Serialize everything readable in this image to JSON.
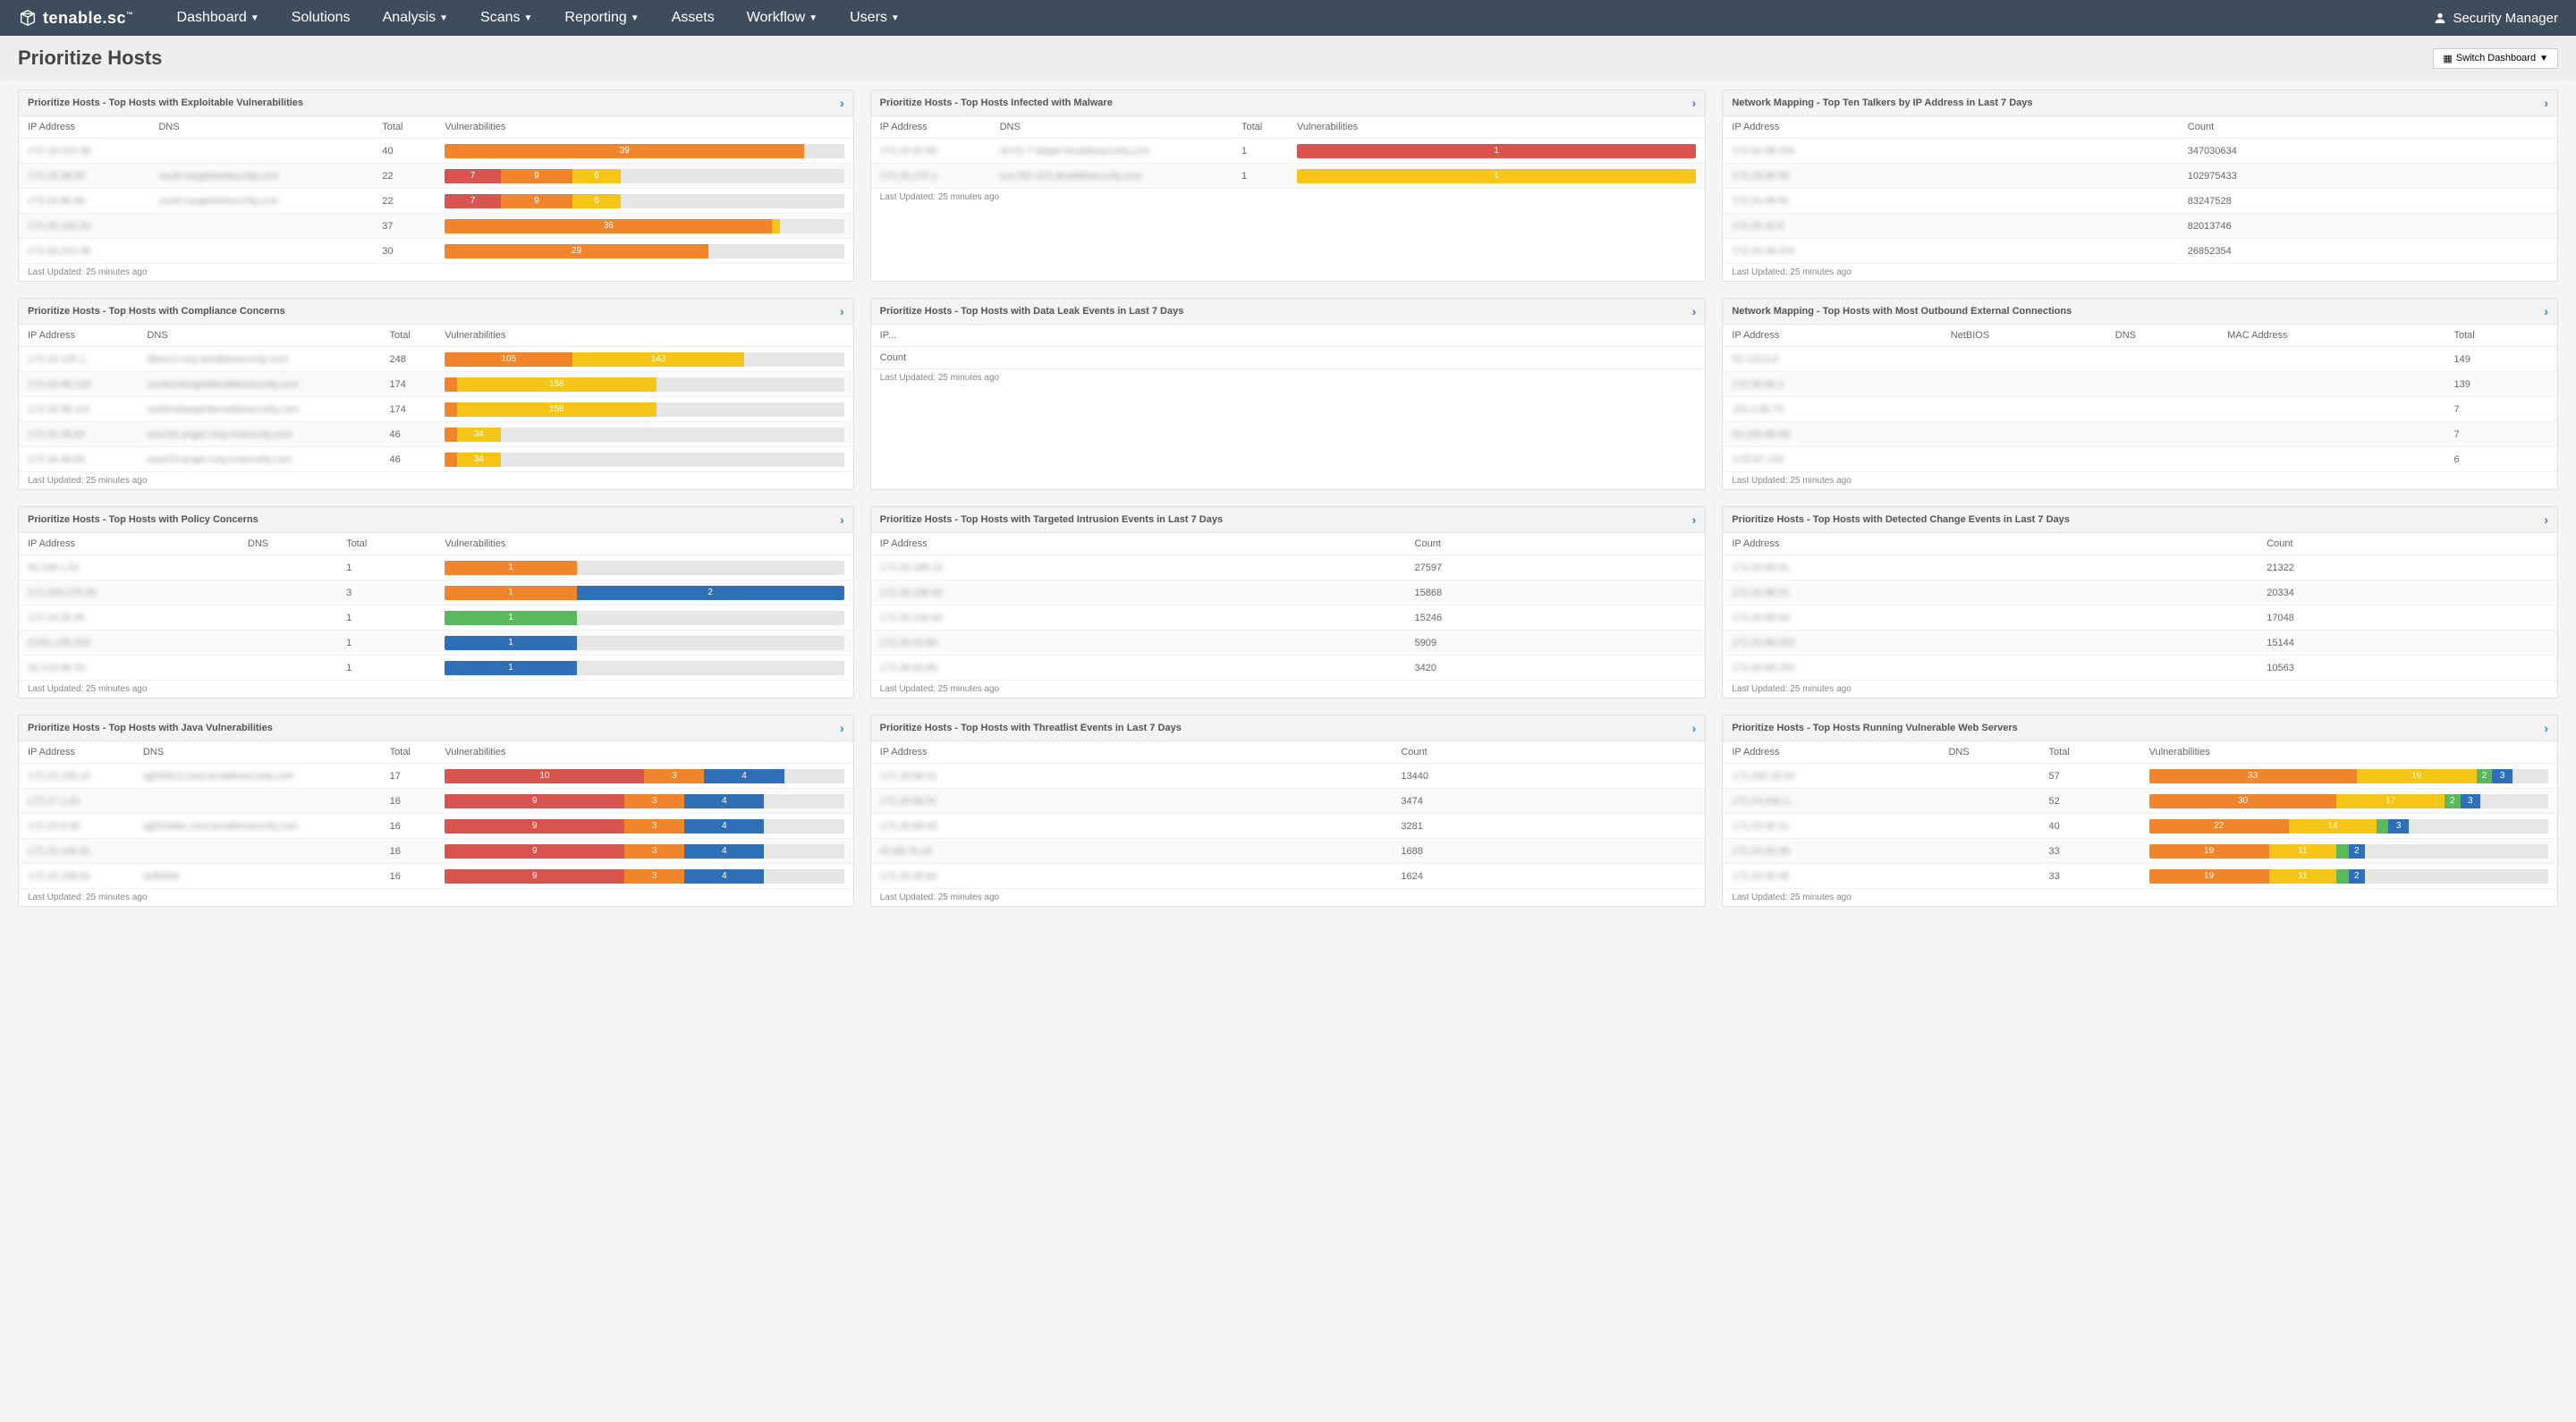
{
  "brand": "tenable.sc",
  "nav": [
    "Dashboard",
    "Solutions",
    "Analysis",
    "Scans",
    "Reporting",
    "Assets",
    "Workflow",
    "Users"
  ],
  "nav_carets": [
    true,
    false,
    true,
    true,
    true,
    false,
    true,
    true
  ],
  "user": "Security Manager",
  "page_title": "Prioritize Hosts",
  "switch_dashboard": "Switch Dashboard",
  "footer_text": "Last Updated: 25 minutes ago",
  "hdr": {
    "ip": "IP Address",
    "dns": "DNS",
    "total": "Total",
    "vuln": "Vulnerabilities",
    "count": "Count",
    "netbios": "NetBIOS",
    "mac": "MAC Address"
  },
  "cards": [
    {
      "id": "exploit",
      "title": "Prioritize Hosts - Top Hosts with Exploitable Vulnerabilities",
      "cols": [
        "ip",
        "dns",
        "total",
        "vuln"
      ],
      "rows": [
        {
          "ip": "172.18.210.98",
          "dns": "",
          "total": 40,
          "bar": [
            [
              "orange",
              39,
              90
            ]
          ],
          "pad": 10
        },
        {
          "ip": "172.26.88.89",
          "dns": "south.targetnetsecurity.com",
          "total": 22,
          "bar": [
            [
              "red",
              7,
              14
            ],
            [
              "orange",
              9,
              18
            ],
            [
              "yellow",
              6,
              12
            ]
          ],
          "pad": 56
        },
        {
          "ip": "172.26.88.89",
          "dns": "south.targetnetsecurity.com",
          "total": 22,
          "bar": [
            [
              "red",
              7,
              14
            ],
            [
              "orange",
              9,
              18
            ],
            [
              "yellow",
              6,
              12
            ]
          ],
          "pad": 56
        },
        {
          "ip": "172.26.240.94",
          "dns": "",
          "total": 37,
          "bar": [
            [
              "orange",
              36,
              82
            ],
            [
              "yellow",
              "",
              2
            ]
          ],
          "pad": 16
        },
        {
          "ip": "172.26.210.98",
          "dns": "",
          "total": 30,
          "bar": [
            [
              "orange",
              29,
              66
            ]
          ],
          "pad": 34
        }
      ]
    },
    {
      "id": "malware",
      "title": "Prioritize Hosts - Top Hosts Infected with Malware",
      "cols": [
        "ip",
        "dns",
        "total",
        "vuln"
      ],
      "rows": [
        {
          "ip": "172.26.90.90",
          "dns": "cb-01-7.target.tenablesecurity.com",
          "total": 1,
          "bar": [
            [
              "red",
              1,
              100
            ]
          ],
          "pad": 0
        },
        {
          "ip": "172.26.276.1...",
          "dns": "scs.991.415.tenablesecurity.com",
          "total": 1,
          "bar": [
            [
              "yellow",
              1,
              100
            ]
          ],
          "pad": 0
        }
      ]
    },
    {
      "id": "talkers",
      "title": "Network Mapping - Top Ten Talkers by IP Address in Last 7 Days",
      "cols": [
        "ip",
        "count"
      ],
      "rows": [
        {
          "ip": "172.92.88.254",
          "count": "347030634"
        },
        {
          "ip": "172.28.88.90",
          "count": "102975433"
        },
        {
          "ip": "172.26.88.81",
          "count": "83247528"
        },
        {
          "ip": "172.26.40.6",
          "count": "82013746"
        },
        {
          "ip": "172.26.48.254",
          "count": "26852354"
        }
      ]
    },
    {
      "id": "compliance",
      "title": "Prioritize Hosts - Top Hosts with Compliance Concerns",
      "cols": [
        "ip",
        "dns",
        "total",
        "vuln"
      ],
      "rows": [
        {
          "ip": "172.23.105.1...",
          "dns": "dbsvr3.corp.tenablesecurity.com",
          "total": 248,
          "bar": [
            [
              "orange",
              105,
              32
            ],
            [
              "yellow",
              143,
              43
            ]
          ],
          "pad": 25
        },
        {
          "ip": "172.26.88.109",
          "dns": "centerwtarget4tenablesecurity.com",
          "total": 174,
          "bar": [
            [
              "orange",
              "",
              3
            ],
            [
              "yellow",
              158,
              50
            ]
          ],
          "pad": 47
        },
        {
          "ip": "172.26.88.110",
          "dns": "centerwtarget4tenablesecurity.com",
          "total": 174,
          "bar": [
            [
              "orange",
              "",
              3
            ],
            [
              "yellow",
              158,
              50
            ]
          ],
          "pad": 47
        },
        {
          "ip": "172.26.48.82",
          "dns": "ess193.angel.corp.insecurity.com",
          "total": 46,
          "bar": [
            [
              "orange",
              "",
              3
            ],
            [
              "yellow",
              34,
              11
            ]
          ],
          "pad": 86
        },
        {
          "ip": "172.26.48.83",
          "dns": "ess193.angel.corp.insecurity.com",
          "total": 46,
          "bar": [
            [
              "orange",
              "",
              3
            ],
            [
              "yellow",
              34,
              11
            ]
          ],
          "pad": 86
        }
      ]
    },
    {
      "id": "dataleak",
      "title": "Prioritize Hosts - Top Hosts with Data Leak Events in Last 7 Days",
      "cols": [
        "ip_short",
        "count_stacked"
      ],
      "rows": []
    },
    {
      "id": "outbound",
      "title": "Network Mapping - Top Hosts with Most Outbound External Connections",
      "cols": [
        "ip",
        "netbios",
        "dns",
        "mac",
        "total"
      ],
      "rows": [
        {
          "ip": "52.119.9.8",
          "total": 149
        },
        {
          "ip": "172.90.99.1",
          "total": 139
        },
        {
          "ip": "152.2.80.75",
          "total": 7
        },
        {
          "ip": "52.206.88.68",
          "total": 7
        },
        {
          "ip": "4.53.87.243",
          "total": 6
        }
      ]
    },
    {
      "id": "policy",
      "title": "Prioritize Hosts - Top Hosts with Policy Concerns",
      "cols": [
        "ip",
        "dns",
        "total",
        "vuln"
      ],
      "rows": [
        {
          "ip": "50.239.1.51",
          "dns": "",
          "total": 1,
          "bar": [
            [
              "orange",
              1,
              33
            ]
          ],
          "pad": 67
        },
        {
          "ip": "172.305.278.56",
          "dns": "",
          "total": 3,
          "bar": [
            [
              "orange",
              1,
              33
            ],
            [
              "blue",
              2,
              67
            ]
          ],
          "pad": 0
        },
        {
          "ip": "172.19.25.95",
          "dns": "",
          "total": 1,
          "bar": [
            [
              "green",
              1,
              33
            ]
          ],
          "pad": 67
        },
        {
          "ip": "4.591.186.200",
          "dns": "",
          "total": 1,
          "bar": [
            [
              "blue",
              1,
              33
            ]
          ],
          "pad": 67
        },
        {
          "ip": "20.219.96.43",
          "dns": "",
          "total": 1,
          "bar": [
            [
              "blue",
              1,
              33
            ]
          ],
          "pad": 67
        }
      ]
    },
    {
      "id": "intrusion",
      "title": "Prioritize Hosts - Top Hosts with Targeted Intrusion Events in Last 7 Days",
      "cols": [
        "ip",
        "count"
      ],
      "rows": [
        {
          "ip": "172.26.198.10",
          "count": "27597"
        },
        {
          "ip": "172.26.198.93",
          "count": "15868"
        },
        {
          "ip": "172.26.100.92",
          "count": "15246"
        },
        {
          "ip": "172.26.40.84",
          "count": "5909"
        },
        {
          "ip": "172.36.40.86",
          "count": "3420"
        }
      ]
    },
    {
      "id": "change",
      "title": "Prioritize Hosts - Top Hosts with Detected Change Events in Last 7 Days",
      "cols": [
        "ip",
        "count"
      ],
      "rows": [
        {
          "ip": "172.26.88.91",
          "count": "21322"
        },
        {
          "ip": "172.26.88.91",
          "count": "20334"
        },
        {
          "ip": "172.26.88.83",
          "count": "17048"
        },
        {
          "ip": "172.26.88.253",
          "count": "15144"
        },
        {
          "ip": "172.26.88.253",
          "count": "10563"
        }
      ]
    },
    {
      "id": "java",
      "title": "Prioritize Hosts - Top Hosts with Java Vulnerabilities",
      "cols": [
        "ip",
        "dns",
        "total",
        "vuln"
      ],
      "rows": [
        {
          "ip": "172.23.159.10",
          "dns": "agD6813.corp.tenablesecurity.com",
          "total": 17,
          "bar": [
            [
              "red",
              10,
              50
            ],
            [
              "orange",
              3,
              15
            ],
            [
              "blue",
              4,
              20
            ]
          ],
          "pad": 15
        },
        {
          "ip": "172.27.1.62",
          "dns": "",
          "total": 16,
          "bar": [
            [
              "red",
              9,
              45
            ],
            [
              "orange",
              3,
              15
            ],
            [
              "blue",
              4,
              20
            ]
          ],
          "pad": 20
        },
        {
          "ip": "172.23.9.45",
          "dns": "agDHiddo.corp.tenablesecurity.com",
          "total": 16,
          "bar": [
            [
              "red",
              9,
              45
            ],
            [
              "orange",
              3,
              15
            ],
            [
              "blue",
              4,
              20
            ]
          ],
          "pad": 20
        },
        {
          "ip": "172.26.108.91",
          "dns": "",
          "total": 16,
          "bar": [
            [
              "red",
              9,
              45
            ],
            [
              "orange",
              3,
              15
            ],
            [
              "blue",
              4,
              20
            ]
          ],
          "pad": 20
        },
        {
          "ip": "172.23.108.91",
          "dns": "softWeb",
          "total": 16,
          "bar": [
            [
              "red",
              9,
              45
            ],
            [
              "orange",
              3,
              15
            ],
            [
              "blue",
              4,
              20
            ]
          ],
          "pad": 20
        }
      ]
    },
    {
      "id": "threatlist",
      "title": "Prioritize Hosts - Top Hosts with Threatlist Events in Last 7 Days",
      "cols": [
        "ip",
        "count"
      ],
      "rows": [
        {
          "ip": "172.18.88.91",
          "count": "13440"
        },
        {
          "ip": "172.26.88.91",
          "count": "3474"
        },
        {
          "ip": "172.26.88.93",
          "count": "3281"
        },
        {
          "ip": "42.88.78.18",
          "count": "1688"
        },
        {
          "ip": "172.26.40.84",
          "count": "1624"
        }
      ]
    },
    {
      "id": "webservers",
      "title": "Prioritize Hosts - Top Hosts Running Vulnerable Web Servers",
      "cols": [
        "ip",
        "dns",
        "total",
        "vuln"
      ],
      "rows": [
        {
          "ip": "172.290.18.54",
          "dns": "",
          "total": 57,
          "bar": [
            [
              "orange",
              33,
              52
            ],
            [
              "yellow",
              19,
              30
            ],
            [
              "green",
              2,
              4
            ],
            [
              "blue",
              3,
              5
            ]
          ],
          "pad": 9
        },
        {
          "ip": "172.23.206.1...",
          "dns": "",
          "total": 52,
          "bar": [
            [
              "orange",
              30,
              47
            ],
            [
              "yellow",
              17,
              27
            ],
            [
              "green",
              2,
              4
            ],
            [
              "blue",
              3,
              5
            ]
          ],
          "pad": 17
        },
        {
          "ip": "172.23.90.51",
          "dns": "",
          "total": 40,
          "bar": [
            [
              "orange",
              22,
              35
            ],
            [
              "yellow",
              14,
              22
            ],
            [
              "green",
              "",
              3
            ],
            [
              "blue",
              3,
              5
            ]
          ],
          "pad": 35
        },
        {
          "ip": "172.23.90.95",
          "dns": "",
          "total": 33,
          "bar": [
            [
              "orange",
              19,
              30
            ],
            [
              "yellow",
              11,
              17
            ],
            [
              "green",
              "",
              3
            ],
            [
              "blue",
              2,
              4
            ]
          ],
          "pad": 46
        },
        {
          "ip": "172.23.90.95",
          "dns": "",
          "total": 33,
          "bar": [
            [
              "orange",
              19,
              30
            ],
            [
              "yellow",
              11,
              17
            ],
            [
              "green",
              "",
              3
            ],
            [
              "blue",
              2,
              4
            ]
          ],
          "pad": 46
        }
      ]
    }
  ]
}
